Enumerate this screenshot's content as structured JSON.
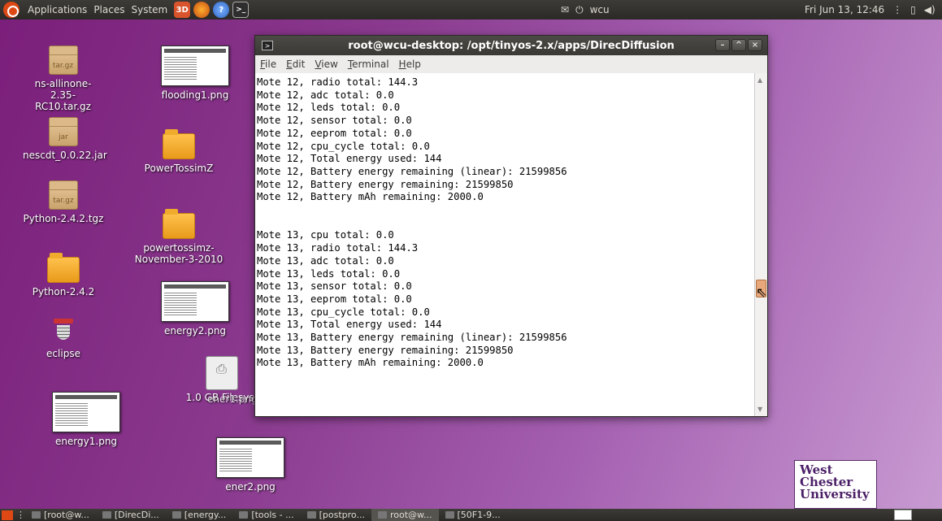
{
  "top_panel": {
    "menus": [
      "Applications",
      "Places",
      "System"
    ],
    "launchers": [
      {
        "icon": "app-icon",
        "label": "3D"
      },
      {
        "icon": "firefox-icon",
        "label": ""
      },
      {
        "icon": "help-icon",
        "label": "?"
      },
      {
        "icon": "terminal-icon",
        "label": ">_"
      }
    ],
    "user": "wcu",
    "datetime": "Fri Jun 13, 12:46"
  },
  "desktop_icons": [
    {
      "label": "ns-allinone-2.35-RC10.tar.gz",
      "badge": "tar.gz"
    },
    {
      "label": "nescdt_0.0.22.jar",
      "badge": "jar"
    },
    {
      "label": "Python-2.4.2.tgz",
      "badge": "tar.gz"
    },
    {
      "label": "Python-2.4.2"
    },
    {
      "label": "eclipse"
    },
    {
      "label": "energy1.png"
    },
    {
      "label": "flooding1.png"
    },
    {
      "label": "PowerTossimZ"
    },
    {
      "label": "powertossimz-November-3-2010"
    },
    {
      "label": "energy2.png"
    },
    {
      "label": "1.0 GB Filesyst"
    },
    {
      "label": "ener1.png"
    },
    {
      "label": "ener2.png"
    }
  ],
  "terminal": {
    "title": "root@wcu-desktop: /opt/tinyos-2.x/apps/DirecDiffusion",
    "menu": [
      "File",
      "Edit",
      "View",
      "Terminal",
      "Help"
    ],
    "lines": [
      "Mote 12, radio total: 144.3",
      "Mote 12, adc total: 0.0",
      "Mote 12, leds total: 0.0",
      "Mote 12, sensor total: 0.0",
      "Mote 12, eeprom total: 0.0",
      "Mote 12, cpu_cycle total: 0.0",
      "Mote 12, Total energy used: 144",
      "Mote 12, Battery energy remaining (linear): 21599856",
      "Mote 12, Battery energy remaining: 21599850",
      "Mote 12, Battery mAh remaining: 2000.0",
      "",
      "",
      "Mote 13, cpu total: 0.0",
      "Mote 13, radio total: 144.3",
      "Mote 13, adc total: 0.0",
      "Mote 13, leds total: 0.0",
      "Mote 13, sensor total: 0.0",
      "Mote 13, eeprom total: 0.0",
      "Mote 13, cpu_cycle total: 0.0",
      "Mote 13, Total energy used: 144",
      "Mote 13, Battery energy remaining (linear): 21599856",
      "Mote 13, Battery energy remaining: 21599850",
      "Mote 13, Battery mAh remaining: 2000.0"
    ],
    "scroll_position": 0.68
  },
  "taskbar": [
    {
      "label": "[root@w...",
      "active": false
    },
    {
      "label": "[DirecDi...",
      "active": false
    },
    {
      "label": "[energy...",
      "active": false
    },
    {
      "label": "[tools - ...",
      "active": false
    },
    {
      "label": "[postpro...",
      "active": false
    },
    {
      "label": "root@w...",
      "active": true
    },
    {
      "label": "[50F1-9...",
      "active": false
    }
  ],
  "logo": {
    "lines": [
      "West",
      "Chester",
      "University"
    ]
  },
  "colors": {
    "panel": "#3c3b37",
    "desktop_bg": "#8a3a8e",
    "ubuntu_orange": "#dd4814"
  }
}
